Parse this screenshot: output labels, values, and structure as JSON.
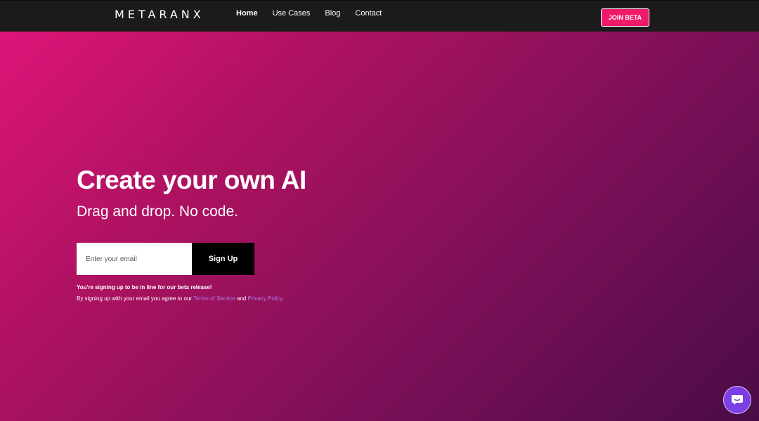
{
  "nav": {
    "logo": "METARANX",
    "links": [
      {
        "label": "Home"
      },
      {
        "label": "Use Cases"
      },
      {
        "label": "Blog"
      },
      {
        "label": "Contact"
      }
    ],
    "cta_label": "JOIN BETA"
  },
  "hero": {
    "title": "Create your own AI",
    "subtitle": "Drag and drop. No code."
  },
  "signup": {
    "email_placeholder": "Enter your email",
    "email_value": "",
    "button_label": "Sign Up",
    "notice": "You're signing up to be in line for our beta release!",
    "terms_prefix": "By signing up with your email you agree to our ",
    "terms_link": "Terms of Service",
    "terms_middle": " and ",
    "privacy_link": "Privacy Policy",
    "terms_suffix": "."
  },
  "chat": {
    "icon": "chat-bubble-icon"
  },
  "colors": {
    "nav_bg": "#1b1b1b",
    "cta_bg": "#f0196a",
    "gradient_start": "#e2147a",
    "gradient_end": "#4a0c45",
    "link": "#b07cf0",
    "chat_bg": "#7b3fe4"
  }
}
